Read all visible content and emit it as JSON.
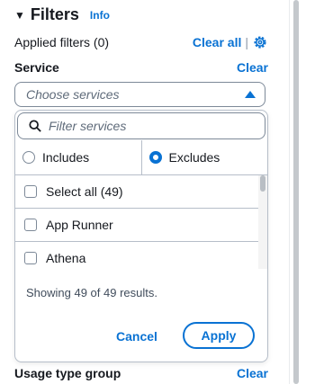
{
  "filters": {
    "title": "Filters",
    "info_label": "Info",
    "applied_label": "Applied filters (0)",
    "clear_all_label": "Clear all",
    "separator": "|"
  },
  "service": {
    "label": "Service",
    "clear_label": "Clear",
    "placeholder": "Choose services"
  },
  "dropdown": {
    "filter_placeholder": "Filter services",
    "radio_options": [
      {
        "label": "Includes",
        "selected": false
      },
      {
        "label": "Excludes",
        "selected": true
      }
    ],
    "options": [
      {
        "label": "Select all (49)",
        "checked": false
      },
      {
        "label": "App Runner",
        "checked": false
      },
      {
        "label": "Athena",
        "checked": false
      }
    ],
    "results_text": "Showing 49 of 49 results.",
    "cancel_label": "Cancel",
    "apply_label": "Apply"
  },
  "usage_type_group": {
    "label": "Usage type group",
    "clear_label": "Clear"
  },
  "colors": {
    "accent": "#0972d3",
    "text": "#16191f",
    "border": "#7d8998"
  },
  "icons": [
    "caret-down-icon",
    "gear-icon",
    "search-icon",
    "triangle-up-icon"
  ]
}
